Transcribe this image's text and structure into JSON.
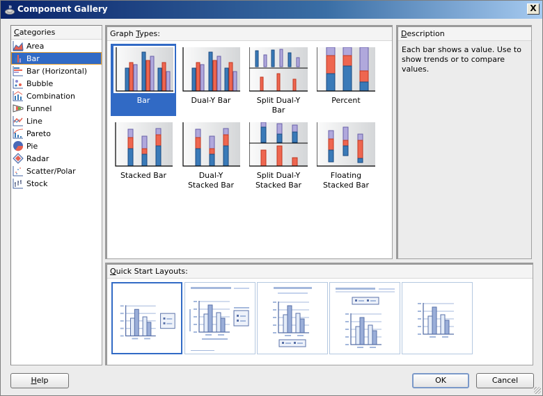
{
  "window": {
    "title": "Component Gallery",
    "close_label": "X"
  },
  "categories": {
    "header": "Categories",
    "header_mnemonic": "C",
    "header_rest": "ategories",
    "items": [
      {
        "label": "Area",
        "icon": "area-chart-icon",
        "selected": false
      },
      {
        "label": "Bar",
        "icon": "bar-chart-icon",
        "selected": true
      },
      {
        "label": "Bar (Horizontal)",
        "icon": "horizontal-bar-chart-icon",
        "selected": false
      },
      {
        "label": "Bubble",
        "icon": "bubble-chart-icon",
        "selected": false
      },
      {
        "label": "Combination",
        "icon": "combination-chart-icon",
        "selected": false
      },
      {
        "label": "Funnel",
        "icon": "funnel-chart-icon",
        "selected": false
      },
      {
        "label": "Line",
        "icon": "line-chart-icon",
        "selected": false
      },
      {
        "label": "Pareto",
        "icon": "pareto-chart-icon",
        "selected": false
      },
      {
        "label": "Pie",
        "icon": "pie-chart-icon",
        "selected": false
      },
      {
        "label": "Radar",
        "icon": "radar-chart-icon",
        "selected": false
      },
      {
        "label": "Scatter/Polar",
        "icon": "scatter-chart-icon",
        "selected": false
      },
      {
        "label": "Stock",
        "icon": "stock-chart-icon",
        "selected": false
      }
    ]
  },
  "graph_types": {
    "header_pre": "Graph ",
    "header_mnemonic": "T",
    "header_post": "ypes:",
    "items": [
      {
        "label_line1": "Bar",
        "label_line2": "",
        "kind": "bar",
        "selected": true
      },
      {
        "label_line1": "Dual-Y Bar",
        "label_line2": "",
        "kind": "bar",
        "selected": false
      },
      {
        "label_line1": "Split Dual-Y",
        "label_line2": "Bar",
        "kind": "split-bar",
        "selected": false
      },
      {
        "label_line1": "Percent",
        "label_line2": "",
        "kind": "percent",
        "selected": false
      },
      {
        "label_line1": "Stacked Bar",
        "label_line2": "",
        "kind": "stacked",
        "selected": false
      },
      {
        "label_line1": "Dual-Y",
        "label_line2": "Stacked Bar",
        "kind": "stacked",
        "selected": false
      },
      {
        "label_line1": "Split Dual-Y",
        "label_line2": "Stacked Bar",
        "kind": "split-stacked",
        "selected": false
      },
      {
        "label_line1": "Floating",
        "label_line2": "Stacked Bar",
        "kind": "floating",
        "selected": false
      }
    ]
  },
  "description": {
    "header_mnemonic": "D",
    "header_rest": "escription",
    "text": "Each bar shows a value. Use to show trends or to compare values."
  },
  "quick_start": {
    "header_mnemonic": "Q",
    "header_rest": "uick Start Layouts:",
    "layouts": [
      {
        "name": "legend-right",
        "selected": true
      },
      {
        "name": "title-legend-right",
        "selected": false
      },
      {
        "name": "title-legend-bottom",
        "selected": false
      },
      {
        "name": "title-legend-top",
        "selected": false
      },
      {
        "name": "chart-only",
        "selected": false
      }
    ]
  },
  "buttons": {
    "help_mnemonic": "H",
    "help_rest": "elp",
    "ok": "OK",
    "cancel": "Cancel"
  },
  "colors": {
    "selection": "#316ac5",
    "bar_blue": "#3a7ab8",
    "bar_red": "#ee6650",
    "bar_purple": "#a8a0d8"
  }
}
